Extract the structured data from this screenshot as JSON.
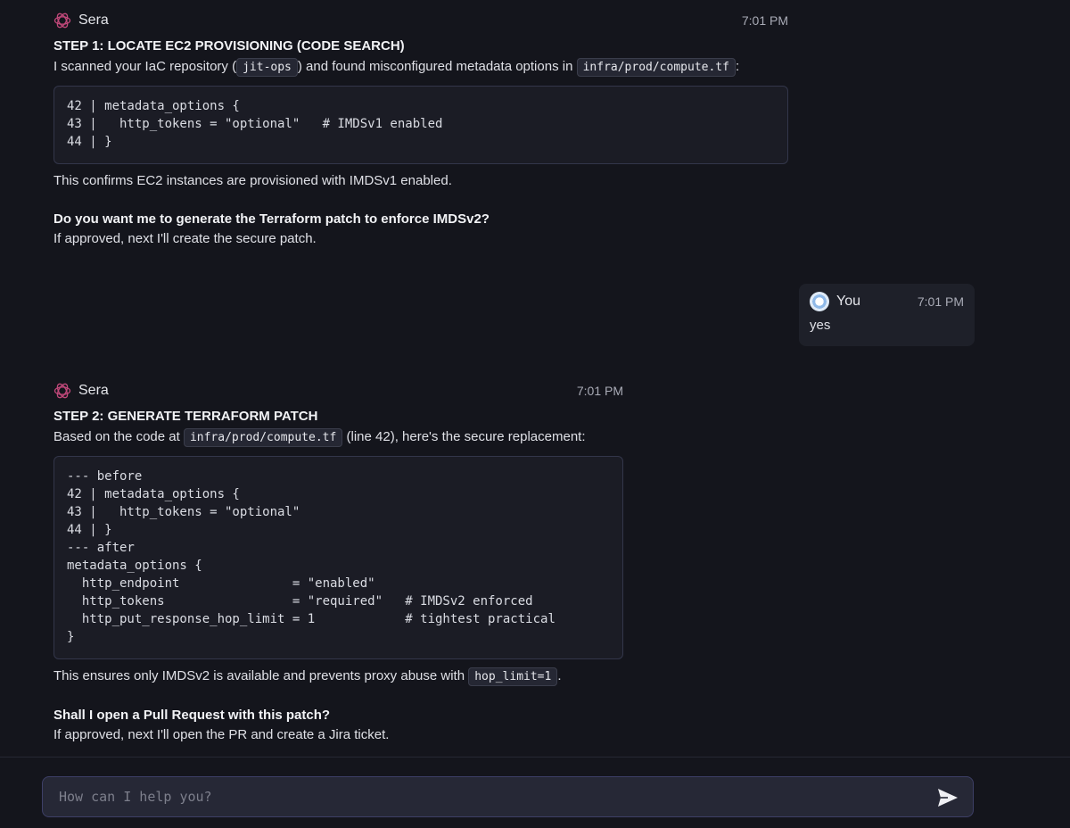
{
  "messages": [
    {
      "sender": "Sera",
      "time": "7:01 PM",
      "step_title": "STEP 1: LOCATE EC2 PROVISIONING (CODE SEARCH)",
      "intro_pre": "I scanned your IaC repository (",
      "intro_code1": "jit-ops",
      "intro_mid": ") and found misconfigured metadata options in",
      "intro_code2": "infra/prod/compute.tf",
      "intro_post": ":",
      "code": "42 | metadata_options {\n43 |   http_tokens = \"optional\"   # IMDSv1 enabled\n44 | }",
      "confirm": "This confirms EC2 instances are provisioned with IMDSv1 enabled.",
      "question": "Do you want me to generate the Terraform patch to enforce IMDSv2?",
      "followup": "If approved, next I'll create the secure patch."
    },
    {
      "sender": "You",
      "time": "7:01 PM",
      "text": "yes"
    },
    {
      "sender": "Sera",
      "time": "7:01 PM",
      "step_title": "STEP 2: GENERATE TERRAFORM PATCH",
      "intro_pre": "Based on the code at",
      "intro_code": "infra/prod/compute.tf",
      "intro_post": "(line 42), here's the secure replacement:",
      "code": "--- before\n42 | metadata_options {\n43 |   http_tokens = \"optional\"\n44 | }\n--- after\nmetadata_options {\n  http_endpoint               = \"enabled\"\n  http_tokens                 = \"required\"   # IMDSv2 enforced\n  http_put_response_hop_limit = 1            # tightest practical\n}",
      "ensure_pre": "This ensures only IMDSv2 is available and prevents proxy abuse with",
      "ensure_code": "hop_limit=1",
      "ensure_post": ".",
      "question": "Shall I open a Pull Request with this patch?",
      "followup": "If approved, next I'll open the PR and create a Jira ticket."
    }
  ],
  "composer": {
    "placeholder": "How can I help you?",
    "value": ""
  },
  "icons": {
    "sera_avatar": "sera-logo-icon",
    "user_avatar": "user-avatar-icon",
    "send": "send-icon"
  },
  "colors": {
    "background": "#14151c",
    "sera_logo": "#c0487a",
    "input_border": "#3d3f66"
  }
}
